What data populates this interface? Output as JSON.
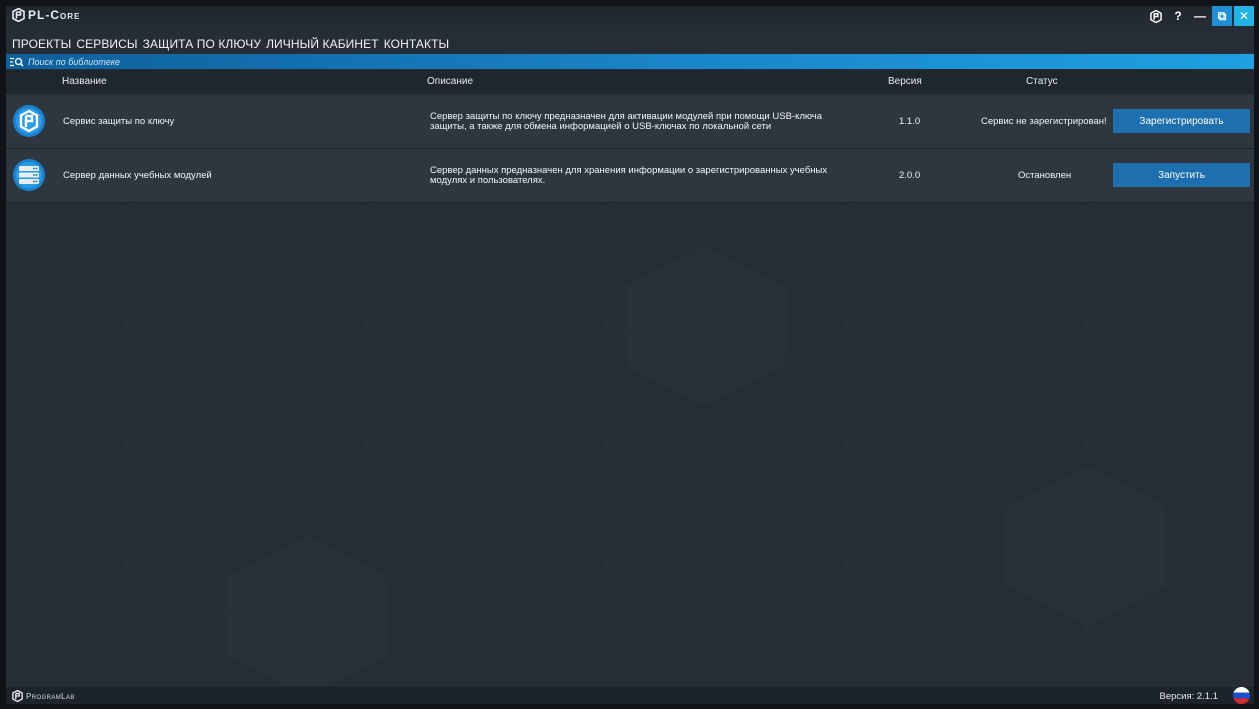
{
  "app": {
    "title": "PL-Core",
    "colors": {
      "accent": "#1f8fd8",
      "button": "#1d6fb0",
      "background": "#262d36",
      "row": "#2e363f"
    }
  },
  "window_controls": {
    "logo_icon": "pl-core-logo-icon",
    "help": "?",
    "minimize": "—",
    "restore": "⧉",
    "close": "✕"
  },
  "menu": {
    "items": [
      {
        "label": "ПРОЕКТЫ",
        "active": false
      },
      {
        "label": "СЕРВИСЫ",
        "active": true
      },
      {
        "label": "ЗАЩИТА ПО КЛЮЧУ",
        "active": false
      },
      {
        "label": "ЛИЧНЫЙ КАБИНЕТ",
        "active": false
      },
      {
        "label": "КОНТАКТЫ",
        "active": false
      }
    ]
  },
  "search": {
    "placeholder": "Поиск по библиотеке",
    "icon": "filter-search-icon"
  },
  "table": {
    "headers": {
      "name": "Название",
      "description": "Описание",
      "version": "Версия",
      "status": "Статус"
    },
    "rows": [
      {
        "icon": "key-protection-service-icon",
        "name": "Сервис защиты по ключу",
        "description_line1": "Сервер защиты по ключу предназначен для активации модулей при помощи USB-ключа",
        "description_line2": "защиты, а также для обмена информацией о USB-ключах по локальной сети",
        "version": "1.1.0",
        "status": "Сервис не зарегистрирован!",
        "action": "Зарегистрировать"
      },
      {
        "icon": "data-server-icon",
        "name": "Сервер данных учебных модулей",
        "description_line1": "Сервер данных предназначен для хранения информации о зарегистрированных учебных",
        "description_line2": "модулях и пользователях.",
        "version": "2.0.0",
        "status": "Остановлен",
        "action": "Запустить"
      }
    ]
  },
  "footer": {
    "brand": "ProgramLab",
    "version_label": "Версия: 2.1.1",
    "language": "russian-flag-icon"
  }
}
